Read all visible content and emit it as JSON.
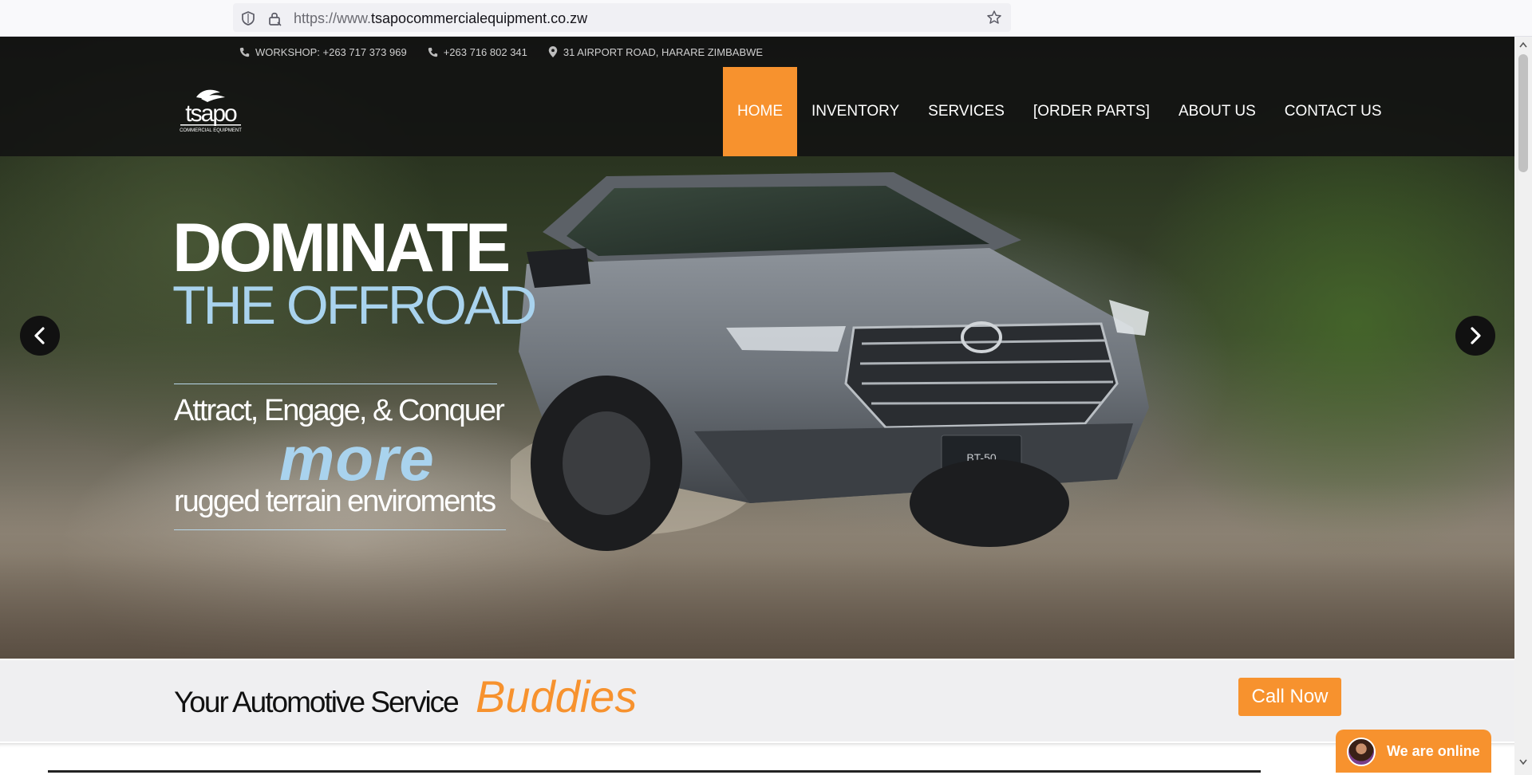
{
  "browser": {
    "url_scheme": "https://www.",
    "url_host": "tsapocommercialequipment.co.zw"
  },
  "contacts": {
    "workshop": "WORKSHOP: +263 717 373 969",
    "phone": "+263 716 802 341",
    "address": "31 AIRPORT ROAD, HARARE ZIMBABWE"
  },
  "logo": {
    "text": "tsapo",
    "subtext": "COMMERCIAL EQUIPMENT"
  },
  "nav": {
    "items": [
      {
        "label": "HOME",
        "active": true
      },
      {
        "label": "INVENTORY",
        "active": false
      },
      {
        "label": "SERVICES",
        "active": false
      },
      {
        "label": "[ORDER PARTS]",
        "active": false
      },
      {
        "label": "ABOUT US",
        "active": false
      },
      {
        "label": "CONTACT US",
        "active": false
      }
    ]
  },
  "hero": {
    "headline_1": "DOMINATE",
    "headline_2": "THE OFFROAD",
    "tagline_1": "Attract, Engage, & Conquer",
    "tagline_more": "more",
    "tagline_2": "rugged terrain enviroments",
    "plate": "BT-50",
    "prev_icon": "chevron-left-icon",
    "next_icon": "chevron-right-icon"
  },
  "service_band": {
    "title": "Your Automotive Service",
    "accent": "Buddies",
    "cta_label": "Call Now"
  },
  "chat": {
    "label": "We are online"
  },
  "colors": {
    "accent": "#f7922e",
    "light_blue": "#a9d3ee",
    "topbar": "#121212"
  }
}
